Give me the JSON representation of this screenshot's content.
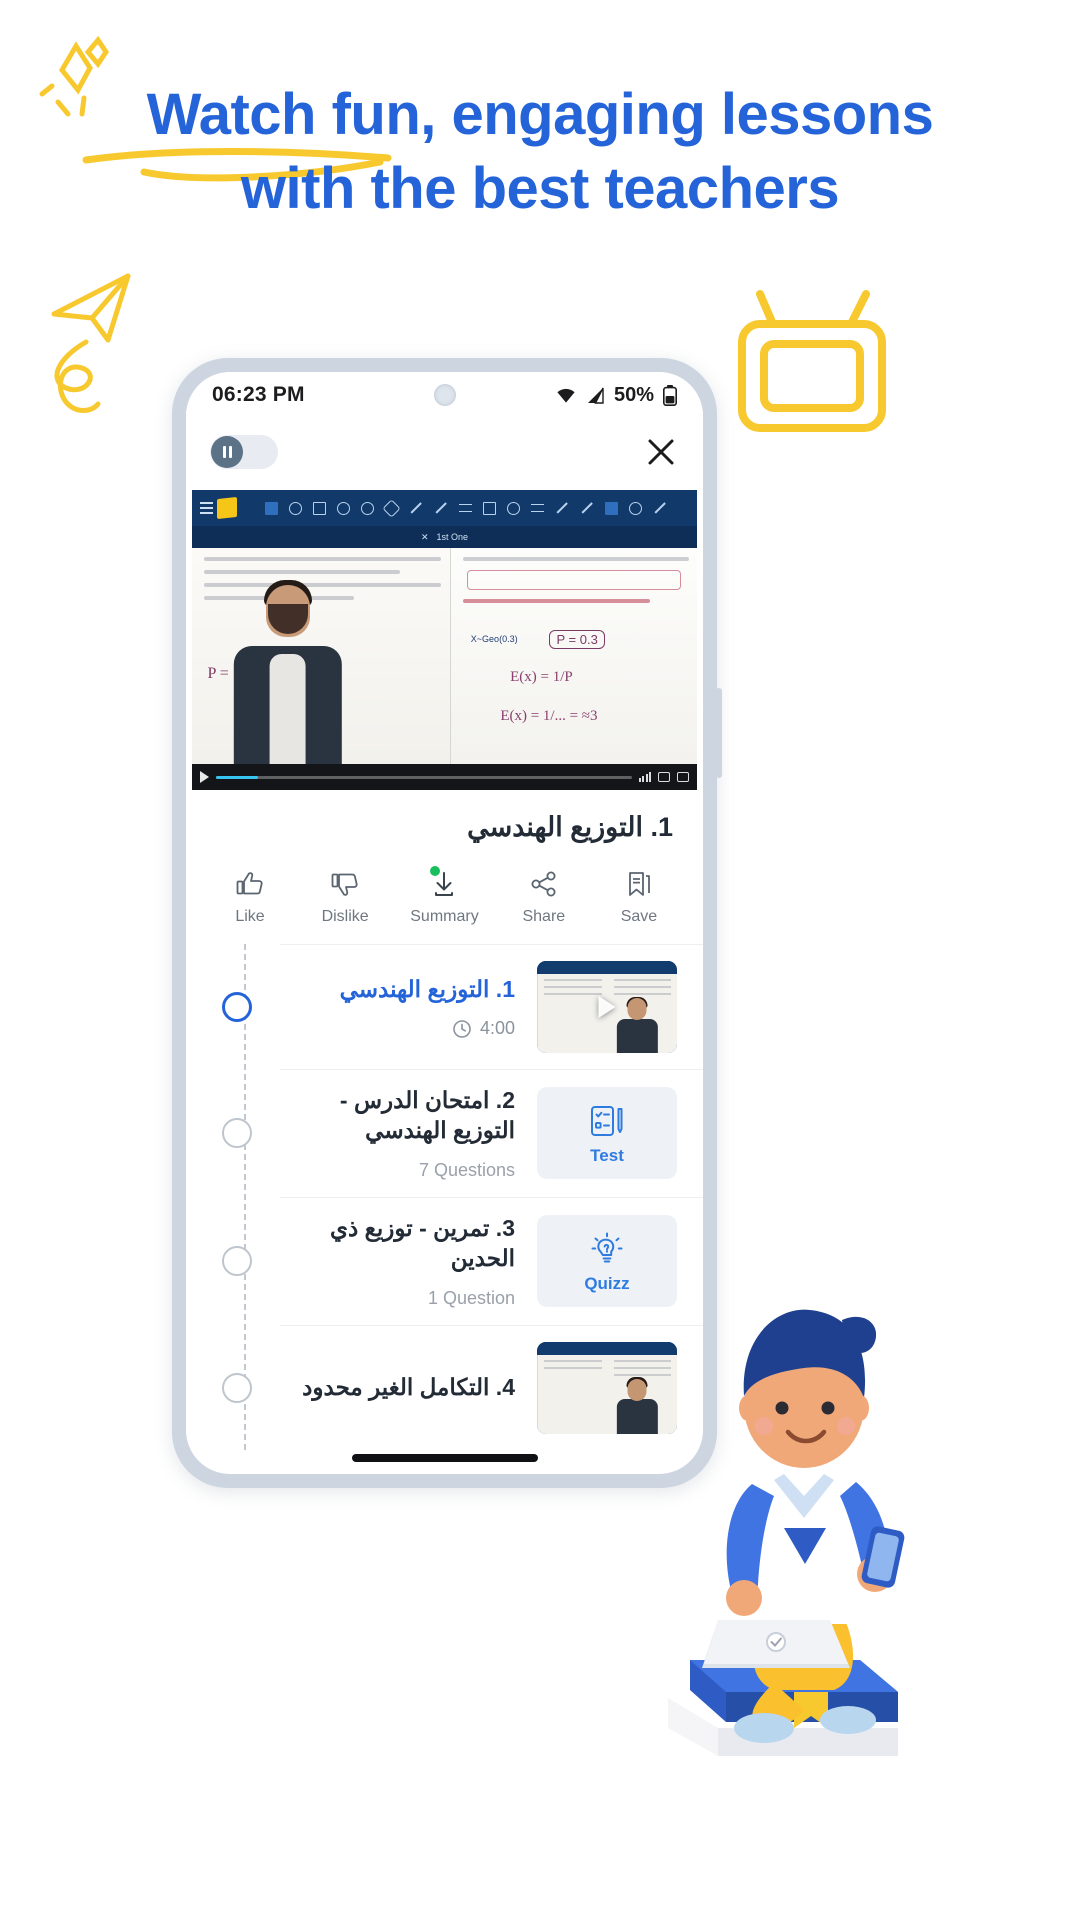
{
  "headline": {
    "line1": "Watch fun, engaging lessons",
    "line2": "with the best teachers",
    "color": "#2563d9",
    "accent_color": "#f7c92e"
  },
  "phone": {
    "status_bar": {
      "time": "06:23 PM",
      "battery_percent": "50%",
      "icons": [
        "wifi-icon",
        "cellular-signal-icon",
        "battery-icon"
      ]
    },
    "top_controls": {
      "pause_toggle": "pause-toggle",
      "close": "close-icon"
    },
    "video": {
      "toolbar_tab": "1st One",
      "tools": [
        "pen-icon",
        "eraser-icon",
        "square-icon",
        "circle-icon",
        "diamond-icon",
        "triangle-icon",
        "line-icon",
        "arrow-icon",
        "curve-icon",
        "select-icon",
        "shape-icon",
        "list-icon",
        "pencil-icon",
        "marker-icon",
        "highlighter-icon",
        "settings-icon",
        "undo-icon",
        "more-icon"
      ],
      "controls": [
        "play-icon",
        "progress-bar",
        "quality-icon",
        "fullscreen-icon",
        "expand-icon"
      ],
      "board_text": {
        "p_formula": "P = 1/3",
        "geo_label": "X~Geo(0.3)",
        "geo_answer": "P = 0.3",
        "expectation_1": "E(x) = 1/P",
        "expectation_2": "E(x) = 1/... = ≈3",
        "ex_box": "E(X) = 1/P"
      }
    },
    "lesson_title": "1. التوزيع الهندسي",
    "actions": [
      {
        "icon": "thumbs-up-icon",
        "label": "Like",
        "badge": false
      },
      {
        "icon": "thumbs-down-icon",
        "label": "Dislike",
        "badge": false
      },
      {
        "icon": "download-icon",
        "label": "Summary",
        "badge": true
      },
      {
        "icon": "share-icon",
        "label": "Share",
        "badge": false
      },
      {
        "icon": "save-icon",
        "label": "Save",
        "badge": false
      }
    ],
    "lessons": [
      {
        "kind": "video",
        "title": "1. التوزيع الهندسي",
        "meta": "4:00",
        "meta_icon": "clock-icon",
        "active": true,
        "tile_label": ""
      },
      {
        "kind": "test",
        "title": "2. امتحان الدرس - التوزيع الهندسي",
        "meta": "7 Questions",
        "meta_icon": "",
        "active": false,
        "tile_label": "Test",
        "tile_icon": "checklist-pencil-icon"
      },
      {
        "kind": "quizz",
        "title": "3. تمرين - توزيع ذي الحدين",
        "meta": "1 Question",
        "meta_icon": "",
        "active": false,
        "tile_label": "Quizz",
        "tile_icon": "lightbulb-question-icon"
      },
      {
        "kind": "video",
        "title": "4. التكامل الغير محدود",
        "meta": "",
        "meta_icon": "",
        "active": false,
        "tile_label": ""
      }
    ]
  },
  "decorations": {
    "sparkle": "sparkle-doodle",
    "paper_plane": "paper-plane-doodle",
    "tv": "tv-doodle",
    "underline": "underline-scribble",
    "mascot": "student-with-phone-mascot"
  }
}
